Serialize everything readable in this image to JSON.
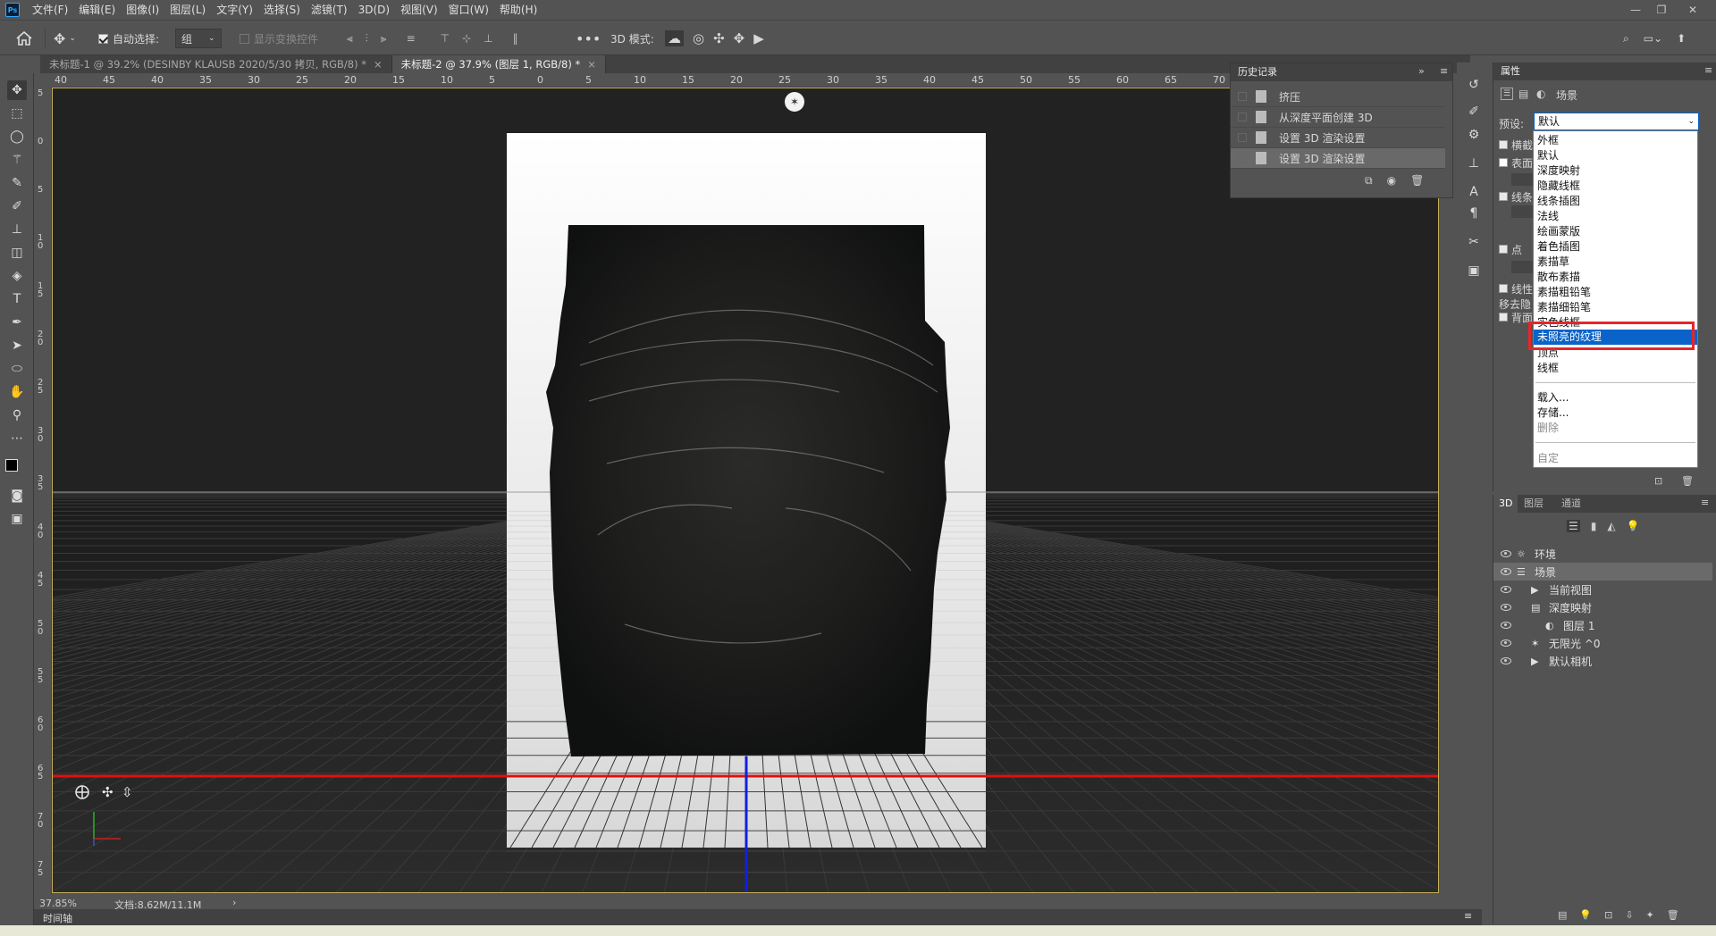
{
  "app": {
    "logo_text": "Ps",
    "menus": [
      "文件(F)",
      "编辑(E)",
      "图像(I)",
      "图层(L)",
      "文字(Y)",
      "选择(S)",
      "滤镜(T)",
      "3D(D)",
      "视图(V)",
      "窗口(W)",
      "帮助(H)"
    ],
    "window_controls": [
      "—",
      "❐",
      "✕"
    ]
  },
  "options": {
    "auto_select_label": "自动选择:",
    "auto_select_value": "组",
    "show_transform_label": "显示变换控件",
    "mode_3d_label": "3D 模式:"
  },
  "tabs": [
    {
      "label": "未标题-1 @ 39.2% (DESINBY KLAUSB    2020/5/30 拷贝, RGB/8) *",
      "active": false
    },
    {
      "label": "未标题-2 @ 37.9% (图层 1, RGB/8) *",
      "active": true
    }
  ],
  "ruler_top": [
    "40",
    "45",
    "40",
    "35",
    "30",
    "25",
    "20",
    "15",
    "10",
    "5",
    "0",
    "5",
    "10",
    "15",
    "20",
    "25",
    "30",
    "35",
    "40",
    "45",
    "50",
    "55",
    "60",
    "65",
    "70"
  ],
  "ruler_left": [
    "5",
    "0",
    "5",
    "1 0",
    "1 5",
    "2 0",
    "2 5",
    "3 0",
    "3 5",
    "4 0",
    "4 5",
    "5 0",
    "5 5",
    "6 0",
    "6 5",
    "7 0",
    "7 5"
  ],
  "status": {
    "zoom": "37.85%",
    "doc_info": "文档:8.62M/11.1M",
    "arrow": "›"
  },
  "timeline_label": "时间轴",
  "history": {
    "title": "历史记录",
    "items": [
      "挤压",
      "从深度平面创建 3D",
      "设置 3D 渲染设置",
      "设置 3D 渲染设置"
    ]
  },
  "properties": {
    "title": "属性",
    "scene_label": "场景",
    "preset_label": "预设:",
    "preset_value": "默认",
    "cross_section": "横截",
    "surface": "表面",
    "lines": "线条",
    "points": "点",
    "linearize": "线性",
    "remove_hidden": "移去隐",
    "backface": "背面"
  },
  "dropdown": {
    "items": [
      "外框",
      "默认",
      "深度映射",
      "隐藏线框",
      "线条插图",
      "法线",
      "绘画蒙版",
      "着色插图",
      "素描草",
      "散布素描",
      "素描粗铅笔",
      "素描细铅笔",
      "实色线框",
      "未照亮的纹理",
      "顶点",
      "线框"
    ],
    "highlighted": "未照亮的纹理",
    "actions": [
      "载入...",
      "存储...",
      "删除"
    ],
    "custom": "自定"
  },
  "panel3d": {
    "tabs": [
      "3D",
      "图层",
      "通道"
    ],
    "scene_items": [
      {
        "label": "环境",
        "indent": 0,
        "icon": "environment-icon"
      },
      {
        "label": "场景",
        "indent": 0,
        "icon": "scene-icon"
      },
      {
        "label": "当前视图",
        "indent": 1,
        "icon": "camera-icon"
      },
      {
        "label": "深度映射",
        "indent": 1,
        "icon": "mesh-icon"
      },
      {
        "label": "图层 1",
        "indent": 2,
        "icon": "material-icon"
      },
      {
        "label": "无限光 ^0",
        "indent": 1,
        "icon": "light-icon"
      },
      {
        "label": "默认相机",
        "indent": 1,
        "icon": "camera-icon"
      }
    ]
  },
  "colors": {
    "accent_blue": "#0a63c8",
    "highlight_red": "#e8252a",
    "canvas_bg": "#222222",
    "panel_bg": "#535353"
  }
}
